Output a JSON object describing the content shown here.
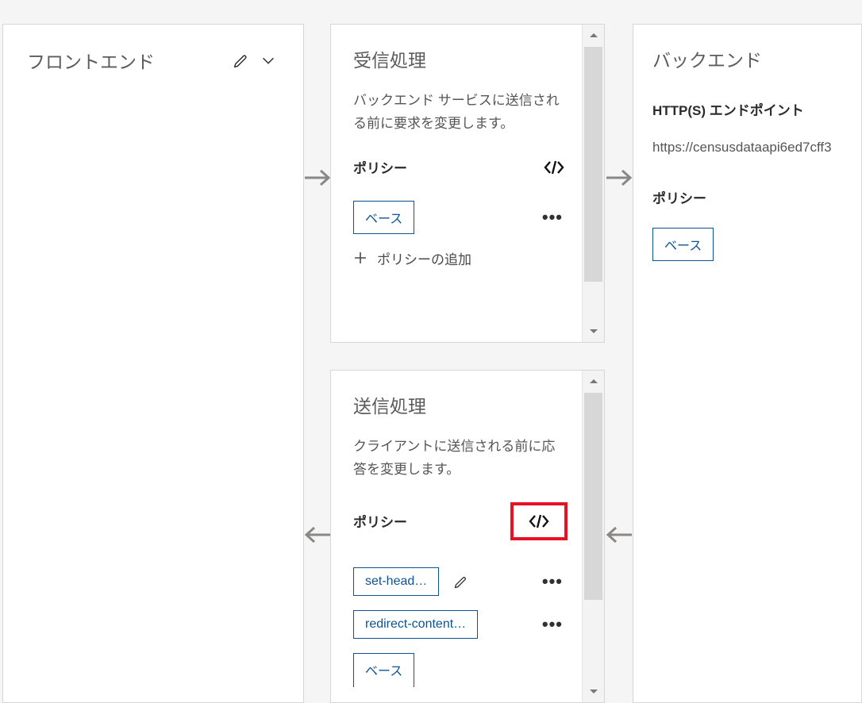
{
  "frontend": {
    "title": "フロントエンド"
  },
  "inbound": {
    "title": "受信処理",
    "desc": "バックエンド サービスに送信される前に要求を変更します。",
    "policy_label": "ポリシー",
    "base_tag": "ベース",
    "add_policy": "ポリシーの追加"
  },
  "outbound": {
    "title": "送信処理",
    "desc": "クライアントに送信される前に応答を変更します。",
    "policy_label": "ポリシー",
    "tags": {
      "set_header": "set-head…",
      "redirect": "redirect-content…",
      "base": "ベース"
    }
  },
  "backend": {
    "title": "バックエンド",
    "endpoint_label": "HTTP(S) エンドポイント",
    "endpoint_url": "https://censusdataapi6ed7cff3",
    "policy_label": "ポリシー",
    "base_tag": "ベース"
  }
}
